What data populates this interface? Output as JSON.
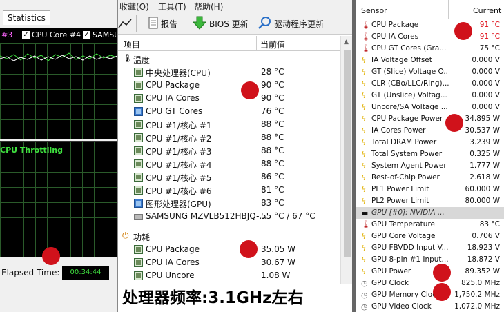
{
  "left": {
    "tab_label": "Statistics",
    "legend": [
      {
        "label": "#3",
        "checked": false,
        "color": "#ff66ff"
      },
      {
        "label": "CPU Core #4",
        "checked": true
      },
      {
        "label": "SAMSU",
        "checked": true
      }
    ],
    "throttling_label": "CPU Throttling",
    "elapsed_label": "Elapsed Time:",
    "elapsed_value": "00:34:44"
  },
  "mid": {
    "menu": [
      "收藏(O)",
      "工具(T)",
      "帮助(H)"
    ],
    "toolbar": {
      "report": "报告",
      "bios": "BIOS 更新",
      "driver": "驱动程序更新"
    },
    "columns": {
      "item": "项目",
      "value": "当前值"
    },
    "temp_section": "温度",
    "temp_rows": [
      {
        "label": "中央处理器(CPU)",
        "value": "28 °C",
        "icon": "cpu-chip-icon"
      },
      {
        "label": "CPU Package",
        "value": "90 °C",
        "icon": "cpu-chip-icon"
      },
      {
        "label": "CPU IA Cores",
        "value": "90 °C",
        "icon": "cpu-chip-icon"
      },
      {
        "label": "CPU GT Cores",
        "value": "76 °C",
        "icon": "gpu-monitor-icon"
      },
      {
        "label": "CPU #1/核心 #1",
        "value": "88 °C",
        "icon": "cpu-chip-icon"
      },
      {
        "label": "CPU #1/核心 #2",
        "value": "88 °C",
        "icon": "cpu-chip-icon"
      },
      {
        "label": "CPU #1/核心 #3",
        "value": "88 °C",
        "icon": "cpu-chip-icon"
      },
      {
        "label": "CPU #1/核心 #4",
        "value": "88 °C",
        "icon": "cpu-chip-icon"
      },
      {
        "label": "CPU #1/核心 #5",
        "value": "86 °C",
        "icon": "cpu-chip-icon"
      },
      {
        "label": "CPU #1/核心 #6",
        "value": "81 °C",
        "icon": "cpu-chip-icon"
      },
      {
        "label": "图形处理器(GPU)",
        "value": "83 °C",
        "icon": "gpu-monitor-icon"
      },
      {
        "label": "SAMSUNG MZVLB512HBJQ-...",
        "value": "55 °C / 67 °C",
        "icon": "disk-drive-icon"
      }
    ],
    "power_section": "功耗",
    "power_rows": [
      {
        "label": "CPU Package",
        "value": "35.05 W",
        "icon": "cpu-chip-icon"
      },
      {
        "label": "CPU IA Cores",
        "value": "30.67 W",
        "icon": "cpu-chip-icon"
      },
      {
        "label": "CPU Uncore",
        "value": "1.08 W",
        "icon": "cpu-chip-icon"
      }
    ],
    "caption": "处理器频率:3.1GHz左右"
  },
  "right": {
    "col_sensor": "Sensor",
    "col_current": "Current",
    "rows": [
      {
        "label": "CPU Package",
        "value": "91 °C",
        "icon": "therm",
        "hot": true
      },
      {
        "label": "CPU IA Cores",
        "value": "91 °C",
        "icon": "therm",
        "hot": true
      },
      {
        "label": "CPU GT Cores (Gra...",
        "value": "75 °C",
        "icon": "therm"
      },
      {
        "label": "IA Voltage Offset",
        "value": "0.000 V",
        "icon": "volt"
      },
      {
        "label": "GT (Slice) Voltage O...",
        "value": "0.000 V",
        "icon": "volt"
      },
      {
        "label": "CLR (CBo/LLC/Ring)...",
        "value": "0.000 V",
        "icon": "volt"
      },
      {
        "label": "GT (Unslice) Voltag...",
        "value": "0.000 V",
        "icon": "volt"
      },
      {
        "label": "Uncore/SA Voltage ...",
        "value": "0.000 V",
        "icon": "volt"
      },
      {
        "label": "CPU Package Power",
        "value": "34.895 W",
        "icon": "volt"
      },
      {
        "label": "IA Cores Power",
        "value": "30.537 W",
        "icon": "volt"
      },
      {
        "label": "Total DRAM Power",
        "value": "3.239 W",
        "icon": "volt"
      },
      {
        "label": "Total System Power",
        "value": "0.325 W",
        "icon": "volt"
      },
      {
        "label": "System Agent Power",
        "value": "1.777 W",
        "icon": "volt"
      },
      {
        "label": "Rest-of-Chip Power",
        "value": "2.618 W",
        "icon": "volt"
      },
      {
        "label": "PL1 Power Limit",
        "value": "60.000 W",
        "icon": "volt"
      },
      {
        "label": "PL2 Power Limit",
        "value": "80.000 W",
        "icon": "volt"
      },
      {
        "label": "GPU [#0]: NVIDIA ...",
        "value": "",
        "icon": "group",
        "group": true
      },
      {
        "label": "GPU Temperature",
        "value": "83 °C",
        "icon": "therm"
      },
      {
        "label": "GPU Core Voltage",
        "value": "0.706 V",
        "icon": "volt"
      },
      {
        "label": "GPU FBVDD Input V...",
        "value": "18.923 V",
        "icon": "volt"
      },
      {
        "label": "GPU 8-pin #1 Input...",
        "value": "18.872 V",
        "icon": "volt"
      },
      {
        "label": "GPU Power",
        "value": "89.352 W",
        "icon": "volt"
      },
      {
        "label": "GPU Clock",
        "value": "825.0 MHz",
        "icon": "clock"
      },
      {
        "label": "GPU Memory Clock",
        "value": "1,750.2 MHz",
        "icon": "clock"
      },
      {
        "label": "GPU Video Clock",
        "value": "1,072.0 MHz",
        "icon": "clock"
      }
    ]
  },
  "colors": {
    "annotation": "#d0121b",
    "hot": "#e0101a",
    "graph_line": "#3fe03f"
  }
}
